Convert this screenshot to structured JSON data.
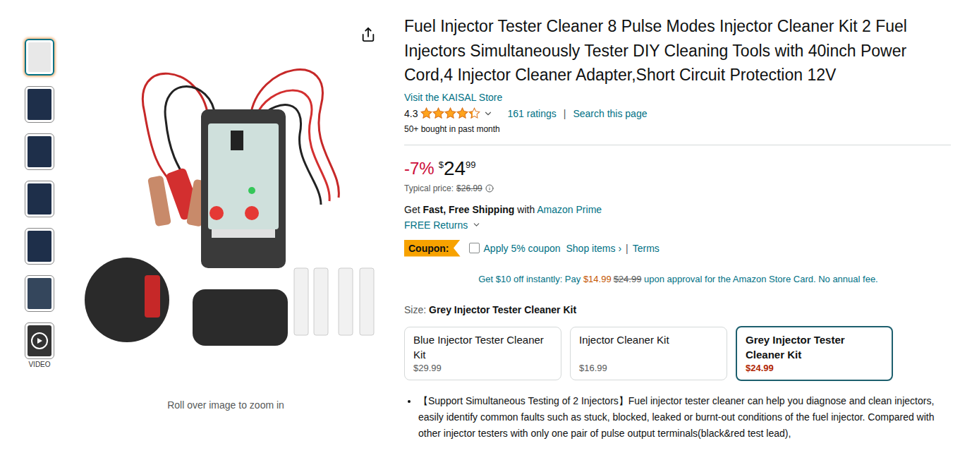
{
  "thumbnails": [
    {
      "kind": "image",
      "selected": true,
      "label": ""
    },
    {
      "kind": "image",
      "selected": false,
      "label": ""
    },
    {
      "kind": "image",
      "selected": false,
      "label": ""
    },
    {
      "kind": "image",
      "selected": false,
      "label": ""
    },
    {
      "kind": "image",
      "selected": false,
      "label": ""
    },
    {
      "kind": "image",
      "selected": false,
      "label": ""
    },
    {
      "kind": "video",
      "selected": false,
      "label": "VIDEO"
    }
  ],
  "image_hint": "Roll over image to zoom in",
  "title": "Fuel Injector Tester Cleaner 8 Pulse Modes Injector Cleaner Kit 2 Fuel Injectors Simultaneously Tester DIY Cleaning Tools with 40inch Power Cord,4 Injector Cleaner Adapter,Short Circuit Protection 12V",
  "store_link": "Visit the KAISAL Store",
  "rating": {
    "value": "4.3",
    "stars": 4.3,
    "count": "161 ratings",
    "separator": "|",
    "search": "Search this page"
  },
  "bought": "50+ bought in past month",
  "price": {
    "discount": "-7%",
    "symbol": "$",
    "whole": "24",
    "fraction": "99",
    "typical_label": "Typical price:",
    "typical": "$26.99"
  },
  "shipping": {
    "prefix": "Get ",
    "bold": "Fast, Free Shipping",
    "middle": " with ",
    "link": "Amazon Prime"
  },
  "returns": "FREE Returns",
  "coupon": {
    "badge": "Coupon:",
    "checked": false,
    "label": "Apply 5% coupon",
    "shop": "Shop items ›",
    "separator": "|",
    "terms": "Terms"
  },
  "store_card": {
    "prefix": "Get $10 off instantly: Pay ",
    "price": "$14.99",
    "old_price": "$24.99",
    "suffix": " upon approval for the Amazon Store Card. No annual fee."
  },
  "size": {
    "label": "Size:",
    "value": "Grey Injector Tester Cleaner Kit",
    "options": [
      {
        "name": "Blue Injector Tester Cleaner Kit",
        "price": "$29.99",
        "selected": false
      },
      {
        "name": "Injector Cleaner Kit",
        "price": "$16.99",
        "selected": false
      },
      {
        "name": "Grey Injector Tester Cleaner Kit",
        "price": "$24.99",
        "selected": true
      }
    ]
  },
  "bullets": [
    "【Support Simultaneous Testing of 2 Injectors】Fuel injector tester cleaner can help you diagnose and clean injectors, easily identify common faults such as stuck, blocked, leaked or burnt-out conditions of the fuel injector. Compared with other injector testers with only one pair of pulse output terminals(black&red test lead),"
  ]
}
